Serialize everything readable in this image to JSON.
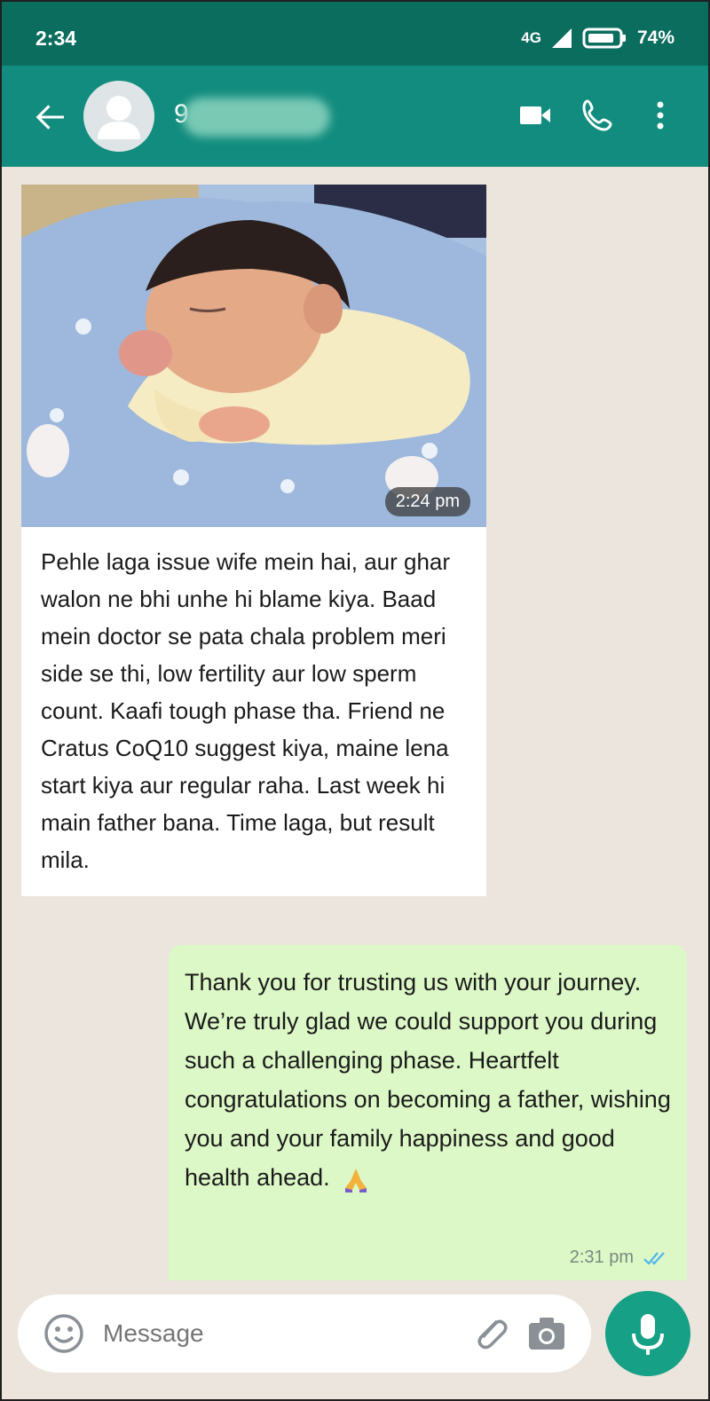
{
  "status_bar": {
    "time": "2:34",
    "network": "4G",
    "battery": "74%"
  },
  "header": {
    "contact_name_visible": "9",
    "icons": [
      "back-arrow-icon",
      "avatar-icon",
      "video-call-icon",
      "phone-icon",
      "more-vert-icon"
    ]
  },
  "messages": [
    {
      "direction": "incoming",
      "image": "newborn-baby-photo",
      "image_time": "2:24 pm",
      "text": "Pehle laga issue wife mein hai, aur ghar walon ne bhi unhe hi blame kiya. Baad mein doctor se pata chala problem meri side se thi, low fertility aur low sperm count. Kaafi tough phase tha. Friend ne Cratus CoQ10 suggest kiya, maine lena start kiya aur regular raha. Last week hi main father bana. Time laga, but result mila."
    },
    {
      "direction": "outgoing",
      "text": "Thank you for trusting us with your journey. We’re truly glad we could support you during such a challenging phase. Heartfelt congratulations on becoming a father, wishing you and your family happiness and good health ahead.",
      "emoji": "folded-hands",
      "time": "2:31 pm",
      "read_status": "double-tick-read"
    }
  ],
  "input": {
    "placeholder": "Message"
  },
  "colors": {
    "status_bar": "#0b6d5e",
    "header": "#128c7e",
    "chat_bg": "#ece5dd",
    "outgoing_bubble": "#dcf8c6",
    "mic_button": "#16a085",
    "read_ticks": "#4fb6ec"
  }
}
